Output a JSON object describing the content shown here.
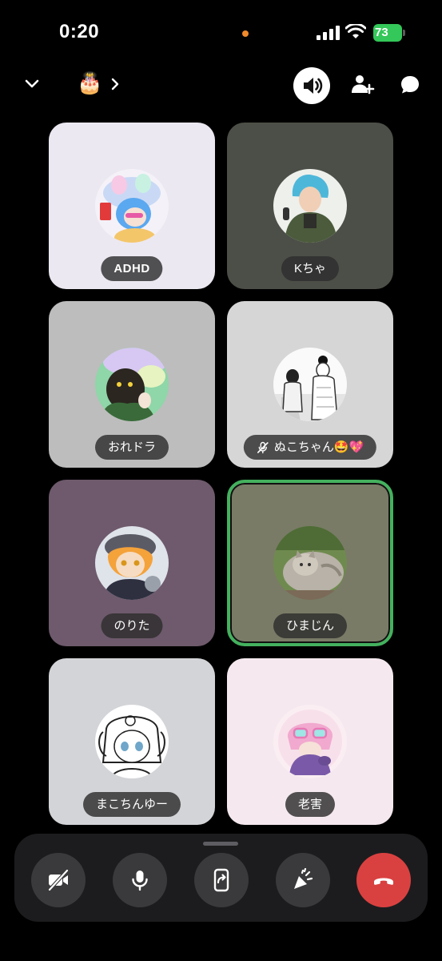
{
  "status_bar": {
    "time": "0:20",
    "battery": "73",
    "recording_dot_color": "#f08a2c"
  },
  "header": {
    "channel_emoji": "🎂",
    "icons": [
      "chevron-down-icon",
      "chevron-right-icon",
      "speaker-icon",
      "add-user-icon",
      "chat-icon"
    ]
  },
  "participants": [
    {
      "name": "ADHD",
      "muted": false,
      "speaking": false,
      "tile_color": "#ece8f1"
    },
    {
      "name": "Kちゃ",
      "muted": false,
      "speaking": false,
      "tile_color": "#4c4f47"
    },
    {
      "name": "おれドラ",
      "muted": false,
      "speaking": false,
      "tile_color": "#bdbdbd"
    },
    {
      "name": "ぬこちゃん🤩💖",
      "muted": true,
      "speaking": false,
      "tile_color": "#d6d6d6"
    },
    {
      "name": "のりた",
      "muted": false,
      "speaking": false,
      "tile_color": "#6e5a6c"
    },
    {
      "name": "ひまじん",
      "muted": false,
      "speaking": true,
      "tile_color": "#797b66"
    },
    {
      "name": "まこちんゆー",
      "muted": false,
      "speaking": false,
      "tile_color": "#d3d4d8"
    },
    {
      "name": "老害",
      "muted": false,
      "speaking": false,
      "tile_color": "#f5e9ef"
    }
  ],
  "controls": {
    "buttons": [
      "camera-off-icon",
      "microphone-icon",
      "screen-share-icon",
      "soundboard-icon",
      "end-call-icon"
    ],
    "end_call_color": "#d94140"
  }
}
